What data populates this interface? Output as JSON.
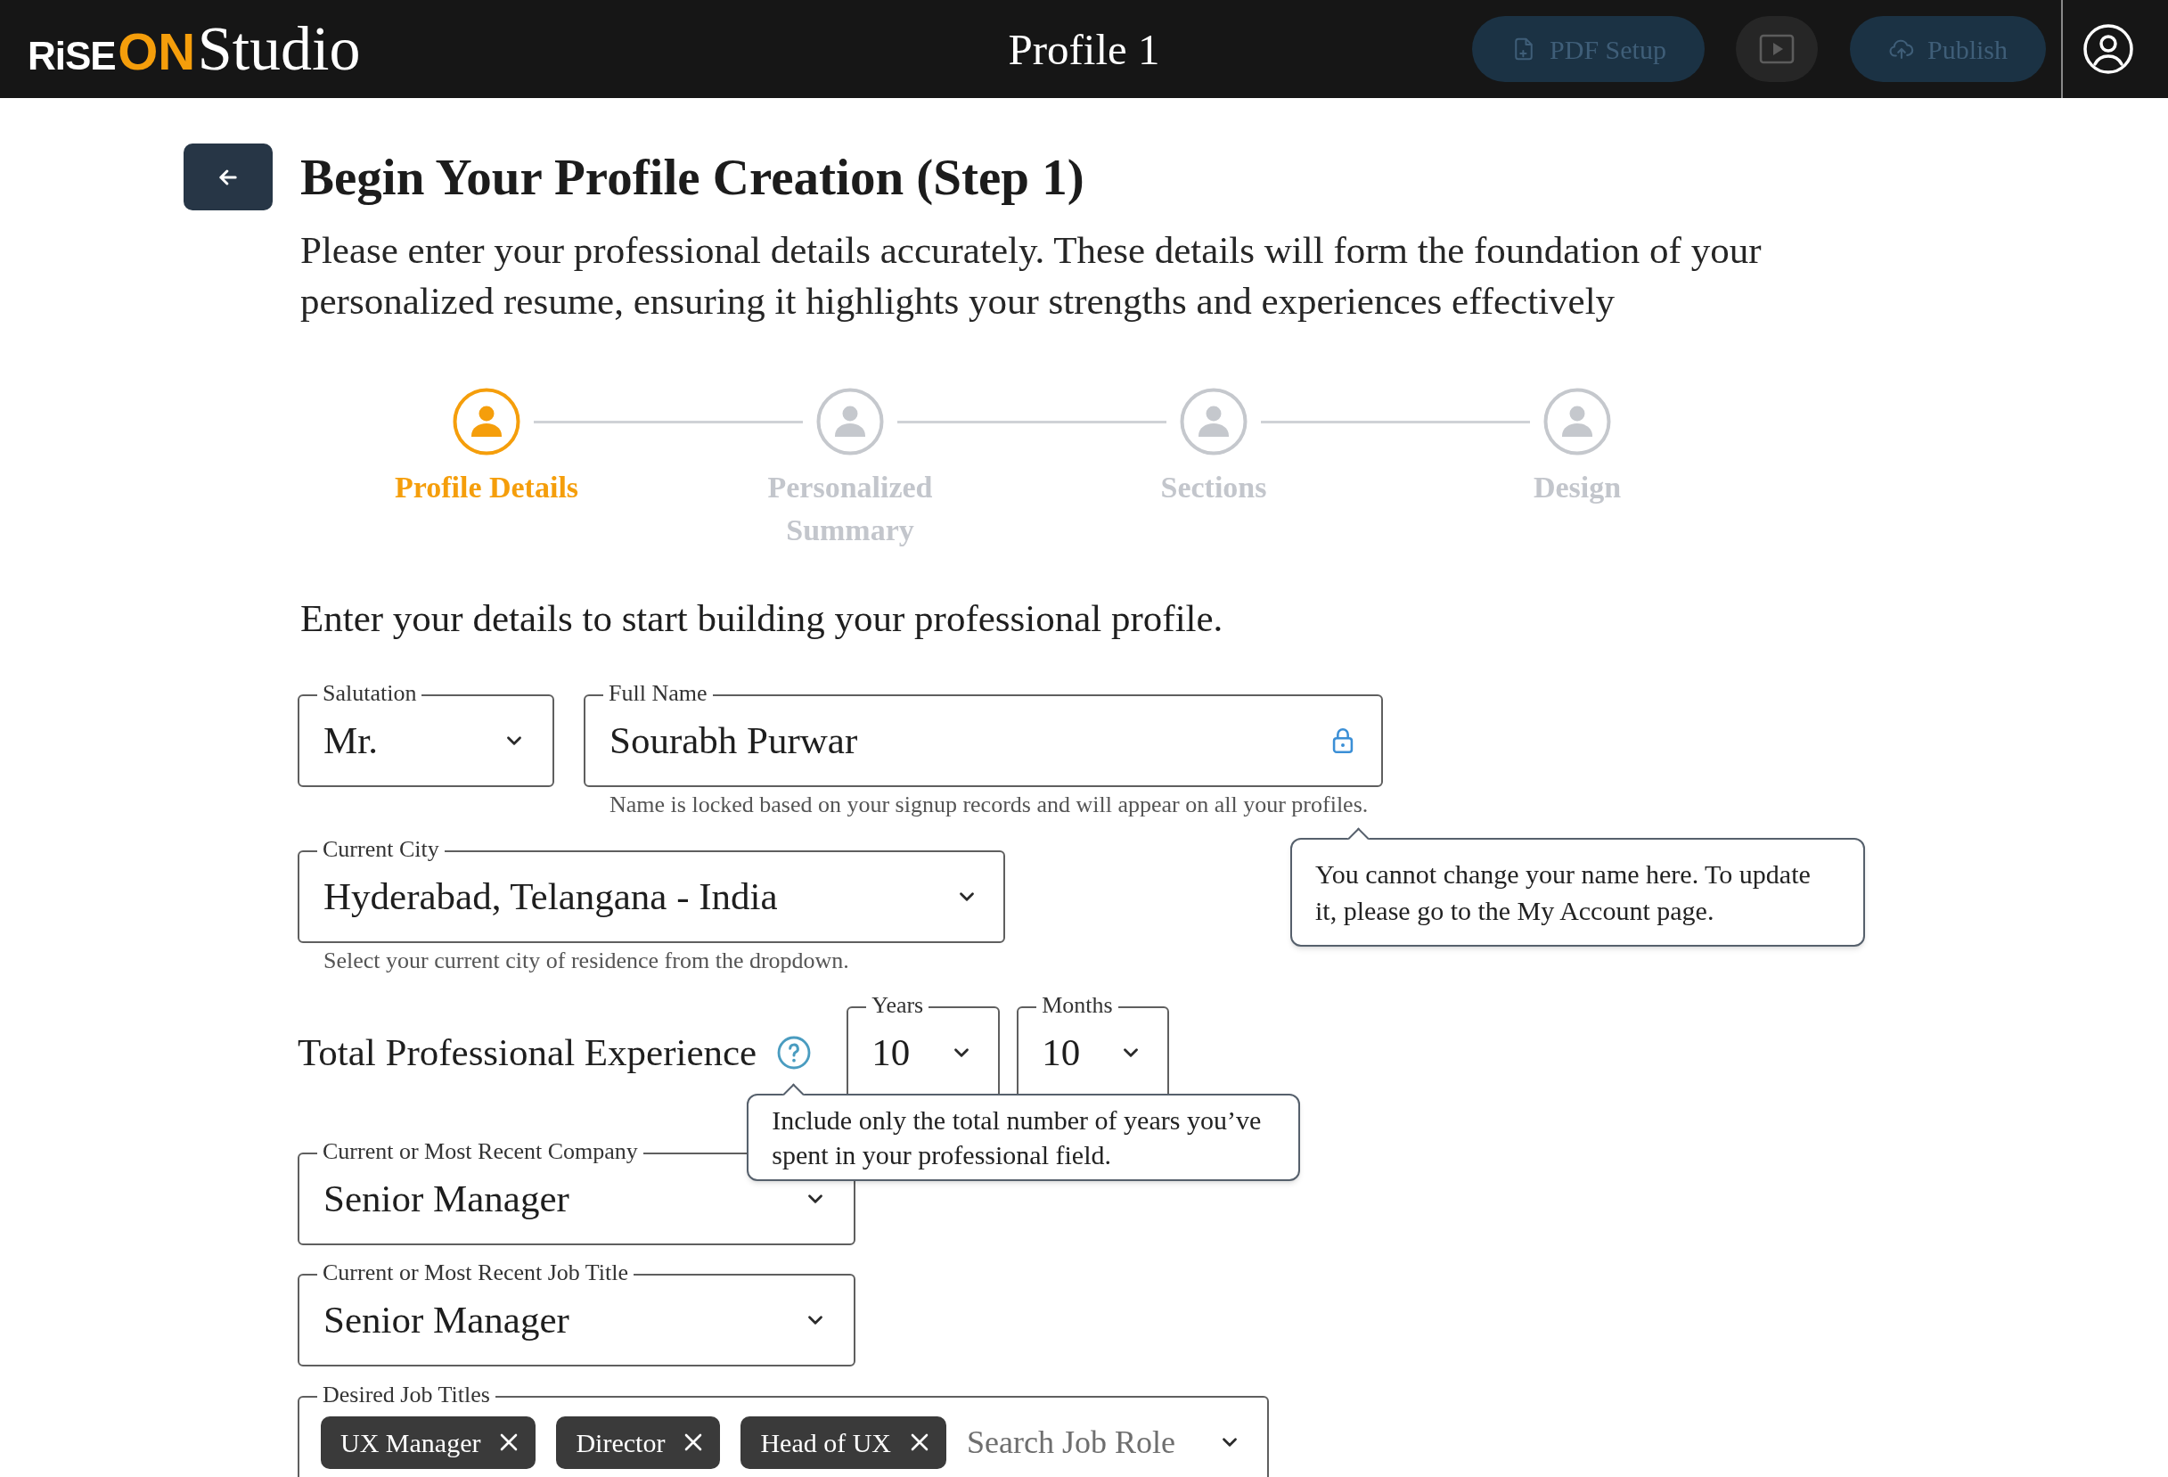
{
  "header": {
    "logo": {
      "wordmark": "RiSE",
      "accent": "ON",
      "product": "Studio"
    },
    "title": "Profile 1",
    "pdf_setup_button": {
      "label": "PDF Setup",
      "disabled": true
    },
    "preview_button": {
      "disabled": true
    },
    "publish_button": {
      "label": "Publish",
      "disabled": true
    }
  },
  "page": {
    "title": "Begin Your Profile Creation (Step 1)",
    "description": "Please enter your professional details accurately. These details will form the foundation of your personalized resume, ensuring it highlights your strengths and experiences effectively"
  },
  "steps": [
    {
      "label": "Profile Details",
      "selected": true
    },
    {
      "label": "Personalized Summary",
      "selected": false
    },
    {
      "label": "Sections",
      "selected": false
    },
    {
      "label": "Design",
      "selected": false
    }
  ],
  "form": {
    "heading": "Enter your details to start building your professional profile.",
    "salutation": {
      "label": "Salutation",
      "value": "Mr."
    },
    "full_name": {
      "label": "Full Name",
      "value": "Sourabh Purwar",
      "locked": true,
      "helper": "Name is locked based on your signup records and will appear on all your profiles.",
      "tooltip": "You cannot change your name here. To update it, please go to the My Account page."
    },
    "current_city": {
      "label": "Current City",
      "value": "Hyderabad, Telangana - India",
      "helper": "Select your current city of residence from the dropdown."
    },
    "experience": {
      "label": "Total Professional Experience",
      "tooltip": "Include only the total number of years you’ve spent in your professional field.",
      "years": {
        "label": "Years",
        "value": "10"
      },
      "months": {
        "label": "Months",
        "value": "10"
      }
    },
    "current_company": {
      "label": "Current or Most Recent Company",
      "value": "Senior Manager"
    },
    "current_job_title": {
      "label": "Current or Most Recent Job Title",
      "value": "Senior Manager"
    },
    "desired_job_titles": {
      "label": "Desired Job Titles",
      "tags": [
        "UX Manager",
        "Director",
        "Head of UX"
      ],
      "placeholder": "Search Job Role"
    }
  }
}
